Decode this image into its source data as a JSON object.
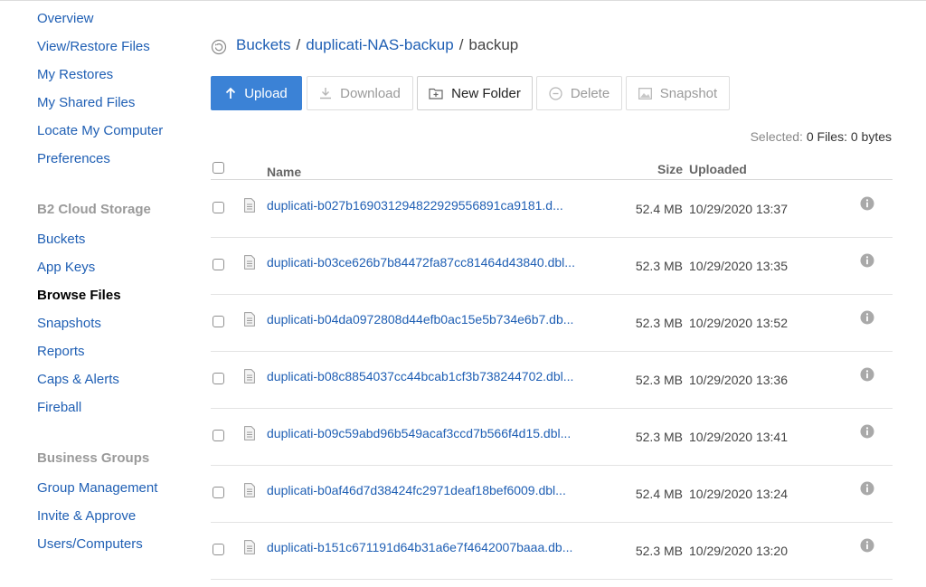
{
  "sidebar": {
    "items": [
      {
        "label": "Overview"
      },
      {
        "label": "View/Restore Files"
      },
      {
        "label": "My Restores"
      },
      {
        "label": "My Shared Files"
      },
      {
        "label": "Locate My Computer"
      },
      {
        "label": "Preferences"
      }
    ],
    "b2_heading": "B2 Cloud Storage",
    "b2_items": [
      {
        "label": "Buckets"
      },
      {
        "label": "App Keys"
      },
      {
        "label": "Browse Files",
        "active": true
      },
      {
        "label": "Snapshots"
      },
      {
        "label": "Reports"
      },
      {
        "label": "Caps & Alerts"
      },
      {
        "label": "Fireball"
      }
    ],
    "business_heading": "Business Groups",
    "business_items": [
      {
        "label": "Group Management"
      },
      {
        "label": "Invite & Approve"
      },
      {
        "label": "Users/Computers"
      }
    ]
  },
  "breadcrumb": {
    "icon": "refresh-icon",
    "parts": [
      "Buckets",
      "duplicati-NAS-backup",
      "backup"
    ],
    "separator": "/"
  },
  "toolbar": {
    "upload": "Upload",
    "download": "Download",
    "new_folder": "New Folder",
    "delete": "Delete",
    "snapshot": "Snapshot"
  },
  "selection": {
    "label": "Selected:",
    "value": "0 Files: 0 bytes"
  },
  "table": {
    "columns": {
      "name": "Name",
      "size": "Size",
      "uploaded": "Uploaded"
    },
    "rows": [
      {
        "name": "duplicati-b027b169031294822929556891ca9181.d...",
        "size": "52.4 MB",
        "uploaded": "10/29/2020 13:37"
      },
      {
        "name": "duplicati-b03ce626b7b84472fa87cc81464d43840.dbl...",
        "size": "52.3 MB",
        "uploaded": "10/29/2020 13:35"
      },
      {
        "name": "duplicati-b04da0972808d44efb0ac15e5b734e6b7.db...",
        "size": "52.3 MB",
        "uploaded": "10/29/2020 13:52"
      },
      {
        "name": "duplicati-b08c8854037cc44bcab1cf3b738244702.dbl...",
        "size": "52.3 MB",
        "uploaded": "10/29/2020 13:36"
      },
      {
        "name": "duplicati-b09c59abd96b549acaf3ccd7b566f4d15.dbl...",
        "size": "52.3 MB",
        "uploaded": "10/29/2020 13:41"
      },
      {
        "name": "duplicati-b0af46d7d38424fc2971deaf18bef6009.dbl...",
        "size": "52.4 MB",
        "uploaded": "10/29/2020 13:24"
      },
      {
        "name": "duplicati-b151c671191d64b31a6e7f4642007baaa.db...",
        "size": "52.3 MB",
        "uploaded": "10/29/2020 13:20"
      }
    ]
  },
  "colors": {
    "link": "#1f5fb4",
    "primary_button": "#3b82d6",
    "muted": "#9a9a9a"
  }
}
